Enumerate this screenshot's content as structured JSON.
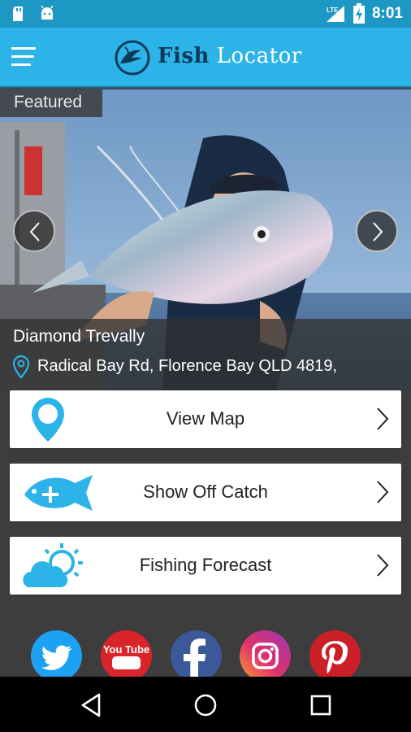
{
  "status_bar": {
    "time": "8:01",
    "network": "LTE",
    "icons": [
      "sd-card-icon",
      "android-icon",
      "lte-signal-icon",
      "battery-charging-icon"
    ]
  },
  "app_bar": {
    "title_bold": "Fish",
    "title_regular": "Locator",
    "accent_color": "#2cb4e8"
  },
  "featured": {
    "badge": "Featured",
    "fish_name": "Diamond Trevally",
    "address": "Radical Bay Rd, Florence Bay QLD 4819,"
  },
  "menu": {
    "items": [
      {
        "label": "View Map",
        "icon": "map-pin-icon"
      },
      {
        "label": "Show Off Catch",
        "icon": "fish-add-icon"
      },
      {
        "label": "Fishing Forecast",
        "icon": "weather-sun-cloud-icon"
      }
    ]
  },
  "social": {
    "items": [
      {
        "name": "twitter",
        "color": "#1da1f2",
        "caption": ""
      },
      {
        "name": "youtube",
        "color": "#d9252a",
        "caption": "You Tube"
      },
      {
        "name": "facebook",
        "color": "#3b5998",
        "caption": ""
      },
      {
        "name": "instagram",
        "color": "#c13584",
        "caption": ""
      },
      {
        "name": "pinterest",
        "color": "#cb2027",
        "caption": ""
      }
    ]
  }
}
